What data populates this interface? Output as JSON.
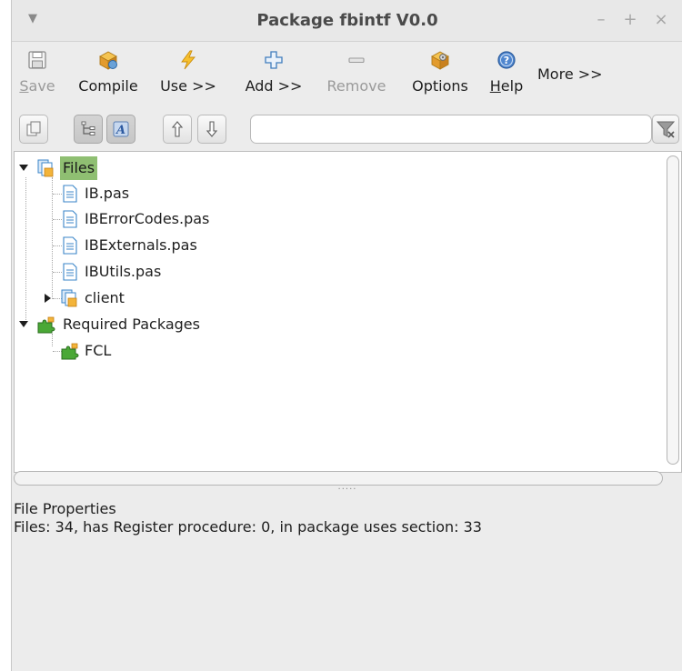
{
  "window": {
    "title": "Package fbintf V0.0",
    "controls": {
      "minimize": "–",
      "maximize": "+",
      "close": "×"
    },
    "menu_glyph": "▼"
  },
  "toolbar": {
    "save": "Save",
    "compile": "Compile",
    "use": "Use >>",
    "add": "Add >>",
    "remove": "Remove",
    "options": "Options",
    "help": "Help",
    "more": "More >>"
  },
  "filter": {
    "value": "",
    "placeholder": ""
  },
  "tree": {
    "files": {
      "label": "Files",
      "items": [
        "IB.pas",
        "IBErrorCodes.pas",
        "IBExternals.pas",
        "IBUtils.pas"
      ],
      "subfolder": "client"
    },
    "required": {
      "label": "Required Packages",
      "items": [
        "FCL"
      ]
    }
  },
  "properties": {
    "title": "File Properties",
    "details": "Files: 34, has Register procedure: 0, in package uses section: 33"
  },
  "splitter_dots": "·····",
  "colors": {
    "selection": "#8fbf72",
    "window_bg": "#ececec",
    "package_green": "#3e9a2c",
    "file_blue": "#3b86c8"
  }
}
